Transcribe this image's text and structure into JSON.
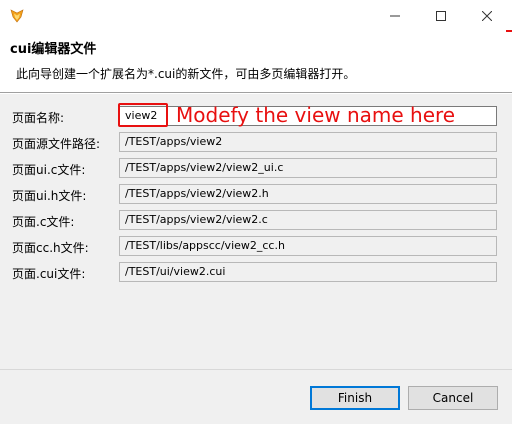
{
  "window": {
    "title": ""
  },
  "header": {
    "title": "cui编辑器文件",
    "description": "此向导创建一个扩展名为*.cui的新文件，可由多页编辑器打开。"
  },
  "form": {
    "rows": [
      {
        "label": "页面名称:",
        "value": "view2"
      },
      {
        "label": "页面源文件路径:",
        "value": "/TEST/apps/view2"
      },
      {
        "label": "页面ui.c文件:",
        "value": "/TEST/apps/view2/view2_ui.c"
      },
      {
        "label": "页面ui.h文件:",
        "value": "/TEST/apps/view2/view2.h"
      },
      {
        "label": "页面.c文件:",
        "value": "/TEST/apps/view2/view2.c"
      },
      {
        "label": "页面cc.h文件:",
        "value": "/TEST/libs/appscc/view2_cc.h"
      },
      {
        "label": "页面.cui文件:",
        "value": "/TEST/ui/view2.cui"
      }
    ]
  },
  "annotation": {
    "text": "Modefy the view name here",
    "color": "#e81010"
  },
  "buttons": {
    "finish": "Finish",
    "cancel": "Cancel"
  },
  "icons": {
    "app": "eclipse-app-icon",
    "minimize": "minimize-icon",
    "maximize": "maximize-icon",
    "close": "close-icon"
  }
}
